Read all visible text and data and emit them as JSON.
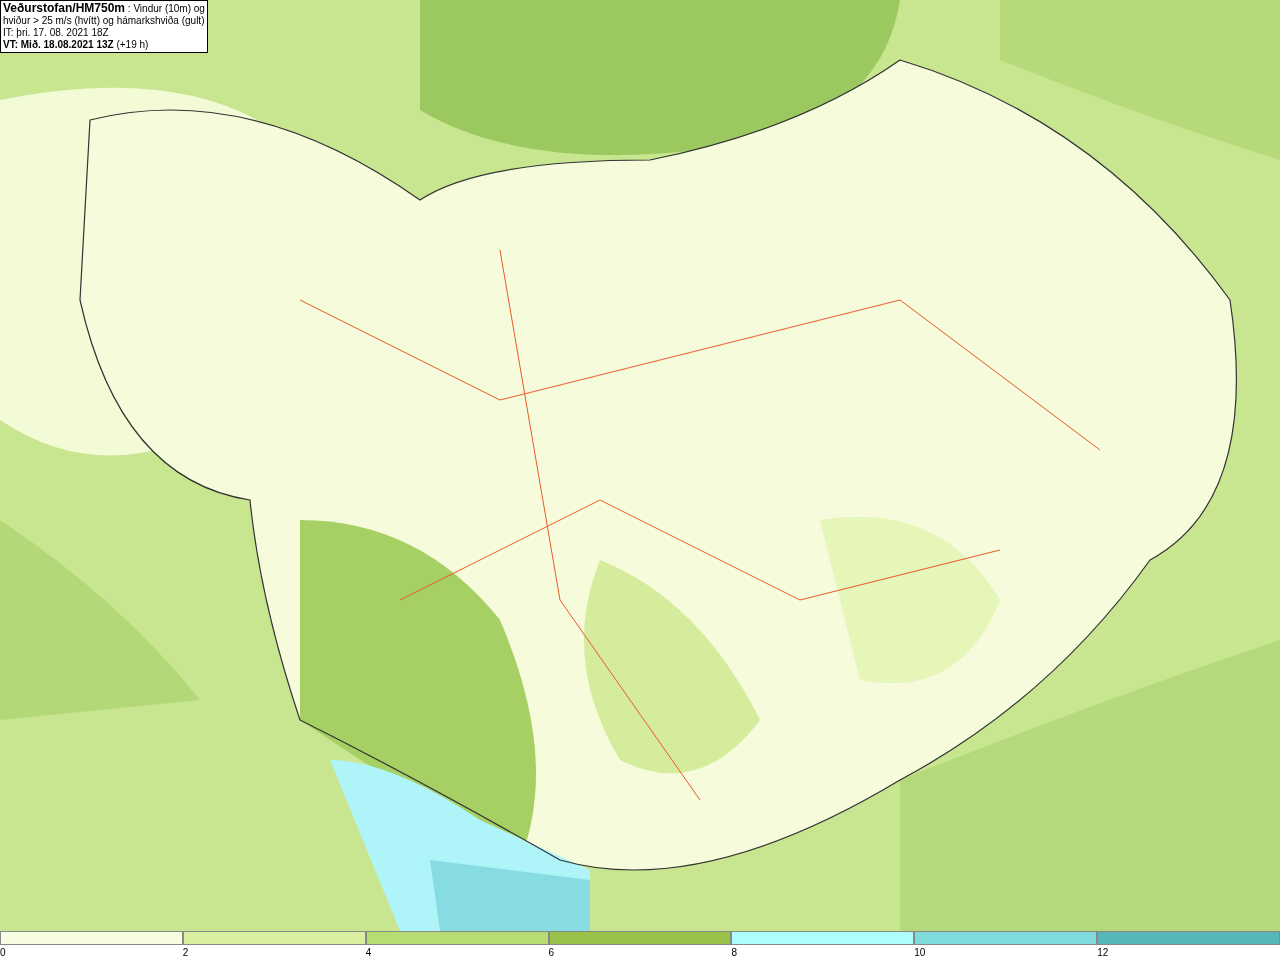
{
  "header": {
    "lines": [
      "**Veðurstofan/HM750m** : Vindur (10m) og",
      "hviður > 25 m/s (hvítt) og hámarkshviða (gult)",
      "IT: þri. 17. 08. 2021 18Z",
      "**VT: Mið. 18.08.2021 13Z** (+19 h)"
    ]
  },
  "legend": [
    {
      "label": "0",
      "color": "#f7fde0"
    },
    {
      "label": "2",
      "color": "#d8f0a0"
    },
    {
      "label": "4",
      "color": "#b8dc74"
    },
    {
      "label": "6",
      "color": "#98c24a"
    },
    {
      "label": "8",
      "color": "#aefdfd"
    },
    {
      "label": "10",
      "color": "#80dcdc"
    },
    {
      "label": "12",
      "color": "#56b6b8"
    }
  ]
}
